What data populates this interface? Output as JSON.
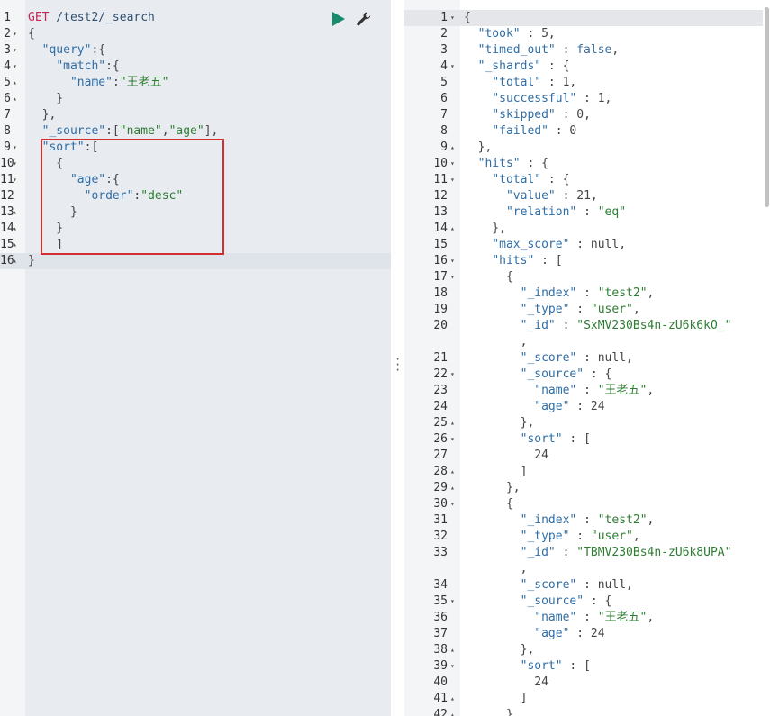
{
  "request": {
    "method": "GET",
    "path": " /test2/_search",
    "lines": [
      [
        [
          "p",
          "{"
        ]
      ],
      [
        [
          "p",
          "  "
        ],
        [
          "k",
          "\"query\""
        ],
        [
          "p",
          ":{"
        ]
      ],
      [
        [
          "p",
          "    "
        ],
        [
          "k",
          "\"match\""
        ],
        [
          "p",
          ":{"
        ]
      ],
      [
        [
          "p",
          "      "
        ],
        [
          "k",
          "\"name\""
        ],
        [
          "p",
          ":"
        ],
        [
          "s",
          "\"王老五\""
        ]
      ],
      [
        [
          "p",
          "    }"
        ]
      ],
      [
        [
          "p",
          "  },"
        ]
      ],
      [
        [
          "p",
          "  "
        ],
        [
          "k",
          "\"_source\""
        ],
        [
          "p",
          ":["
        ],
        [
          "s",
          "\"name\""
        ],
        [
          "p",
          ","
        ],
        [
          "s",
          "\"age\""
        ],
        [
          "p",
          "],"
        ]
      ],
      [
        [
          "p",
          "  "
        ],
        [
          "k",
          "\"sort\""
        ],
        [
          "p",
          ":["
        ]
      ],
      [
        [
          "p",
          "    {"
        ]
      ],
      [
        [
          "p",
          "      "
        ],
        [
          "k",
          "\"age\""
        ],
        [
          "p",
          ":{"
        ]
      ],
      [
        [
          "p",
          "        "
        ],
        [
          "k",
          "\"order\""
        ],
        [
          "p",
          ":"
        ],
        [
          "s",
          "\"desc\""
        ]
      ],
      [
        [
          "p",
          "      }"
        ]
      ],
      [
        [
          "p",
          "    }"
        ]
      ],
      [
        [
          "p",
          "    ]"
        ]
      ],
      [
        [
          "p",
          "}"
        ]
      ]
    ]
  },
  "response": {
    "lines": [
      {
        "n": "1",
        "f": "▾",
        "t": [
          [
            "p",
            "{"
          ]
        ]
      },
      {
        "n": "2",
        "t": [
          [
            "p",
            "  "
          ],
          [
            "k",
            "\"took\""
          ],
          [
            "p",
            " : 5,"
          ]
        ]
      },
      {
        "n": "3",
        "t": [
          [
            "p",
            "  "
          ],
          [
            "k",
            "\"timed_out\""
          ],
          [
            "p",
            " : "
          ],
          [
            "kw",
            "false"
          ],
          [
            "p",
            ","
          ]
        ]
      },
      {
        "n": "4",
        "f": "▾",
        "t": [
          [
            "p",
            "  "
          ],
          [
            "k",
            "\"_shards\""
          ],
          [
            "p",
            " : {"
          ]
        ]
      },
      {
        "n": "5",
        "t": [
          [
            "p",
            "    "
          ],
          [
            "k",
            "\"total\""
          ],
          [
            "p",
            " : 1,"
          ]
        ]
      },
      {
        "n": "6",
        "t": [
          [
            "p",
            "    "
          ],
          [
            "k",
            "\"successful\""
          ],
          [
            "p",
            " : 1,"
          ]
        ]
      },
      {
        "n": "7",
        "t": [
          [
            "p",
            "    "
          ],
          [
            "k",
            "\"skipped\""
          ],
          [
            "p",
            " : 0,"
          ]
        ]
      },
      {
        "n": "8",
        "t": [
          [
            "p",
            "    "
          ],
          [
            "k",
            "\"failed\""
          ],
          [
            "p",
            " : 0"
          ]
        ]
      },
      {
        "n": "9",
        "f": "▴",
        "t": [
          [
            "p",
            "  },"
          ]
        ]
      },
      {
        "n": "10",
        "f": "▾",
        "t": [
          [
            "p",
            "  "
          ],
          [
            "k",
            "\"hits\""
          ],
          [
            "p",
            " : {"
          ]
        ]
      },
      {
        "n": "11",
        "f": "▾",
        "t": [
          [
            "p",
            "    "
          ],
          [
            "k",
            "\"total\""
          ],
          [
            "p",
            " : {"
          ]
        ]
      },
      {
        "n": "12",
        "t": [
          [
            "p",
            "      "
          ],
          [
            "k",
            "\"value\""
          ],
          [
            "p",
            " : 21,"
          ]
        ]
      },
      {
        "n": "13",
        "t": [
          [
            "p",
            "      "
          ],
          [
            "k",
            "\"relation\""
          ],
          [
            "p",
            " : "
          ],
          [
            "s",
            "\"eq\""
          ]
        ]
      },
      {
        "n": "14",
        "f": "▴",
        "t": [
          [
            "p",
            "    },"
          ]
        ]
      },
      {
        "n": "15",
        "t": [
          [
            "p",
            "    "
          ],
          [
            "k",
            "\"max_score\""
          ],
          [
            "p",
            " : null,"
          ]
        ]
      },
      {
        "n": "16",
        "f": "▾",
        "t": [
          [
            "p",
            "    "
          ],
          [
            "k",
            "\"hits\""
          ],
          [
            "p",
            " : ["
          ]
        ]
      },
      {
        "n": "17",
        "f": "▾",
        "t": [
          [
            "p",
            "      {"
          ]
        ]
      },
      {
        "n": "18",
        "t": [
          [
            "p",
            "        "
          ],
          [
            "k",
            "\"_index\""
          ],
          [
            "p",
            " : "
          ],
          [
            "s",
            "\"test2\""
          ],
          [
            "p",
            ","
          ]
        ]
      },
      {
        "n": "19",
        "t": [
          [
            "p",
            "        "
          ],
          [
            "k",
            "\"_type\""
          ],
          [
            "p",
            " : "
          ],
          [
            "s",
            "\"user\""
          ],
          [
            "p",
            ","
          ]
        ]
      },
      {
        "n": "20",
        "t": [
          [
            "p",
            "        "
          ],
          [
            "k",
            "\"_id\""
          ],
          [
            "p",
            " : "
          ],
          [
            "s",
            "\"SxMV230Bs4n-zU6k6kO_\""
          ]
        ]
      },
      {
        "n": "",
        "t": [
          [
            "p",
            "        ,"
          ]
        ]
      },
      {
        "n": "21",
        "t": [
          [
            "p",
            "        "
          ],
          [
            "k",
            "\"_score\""
          ],
          [
            "p",
            " : null,"
          ]
        ]
      },
      {
        "n": "22",
        "f": "▾",
        "t": [
          [
            "p",
            "        "
          ],
          [
            "k",
            "\"_source\""
          ],
          [
            "p",
            " : {"
          ]
        ]
      },
      {
        "n": "23",
        "t": [
          [
            "p",
            "          "
          ],
          [
            "k",
            "\"name\""
          ],
          [
            "p",
            " : "
          ],
          [
            "s",
            "\"王老五\""
          ],
          [
            "p",
            ","
          ]
        ]
      },
      {
        "n": "24",
        "t": [
          [
            "p",
            "          "
          ],
          [
            "k",
            "\"age\""
          ],
          [
            "p",
            " : 24"
          ]
        ]
      },
      {
        "n": "25",
        "f": "▴",
        "t": [
          [
            "p",
            "        },"
          ]
        ]
      },
      {
        "n": "26",
        "f": "▾",
        "t": [
          [
            "p",
            "        "
          ],
          [
            "k",
            "\"sort\""
          ],
          [
            "p",
            " : ["
          ]
        ]
      },
      {
        "n": "27",
        "t": [
          [
            "p",
            "          24"
          ]
        ]
      },
      {
        "n": "28",
        "f": "▴",
        "t": [
          [
            "p",
            "        ]"
          ]
        ]
      },
      {
        "n": "29",
        "f": "▴",
        "t": [
          [
            "p",
            "      },"
          ]
        ]
      },
      {
        "n": "30",
        "f": "▾",
        "t": [
          [
            "p",
            "      {"
          ]
        ]
      },
      {
        "n": "31",
        "t": [
          [
            "p",
            "        "
          ],
          [
            "k",
            "\"_index\""
          ],
          [
            "p",
            " : "
          ],
          [
            "s",
            "\"test2\""
          ],
          [
            "p",
            ","
          ]
        ]
      },
      {
        "n": "32",
        "t": [
          [
            "p",
            "        "
          ],
          [
            "k",
            "\"_type\""
          ],
          [
            "p",
            " : "
          ],
          [
            "s",
            "\"user\""
          ],
          [
            "p",
            ","
          ]
        ]
      },
      {
        "n": "33",
        "t": [
          [
            "p",
            "        "
          ],
          [
            "k",
            "\"_id\""
          ],
          [
            "p",
            " : "
          ],
          [
            "s",
            "\"TBMV230Bs4n-zU6k8UPA\""
          ]
        ]
      },
      {
        "n": "",
        "t": [
          [
            "p",
            "        ,"
          ]
        ]
      },
      {
        "n": "34",
        "t": [
          [
            "p",
            "        "
          ],
          [
            "k",
            "\"_score\""
          ],
          [
            "p",
            " : null,"
          ]
        ]
      },
      {
        "n": "35",
        "f": "▾",
        "t": [
          [
            "p",
            "        "
          ],
          [
            "k",
            "\"_source\""
          ],
          [
            "p",
            " : {"
          ]
        ]
      },
      {
        "n": "36",
        "t": [
          [
            "p",
            "          "
          ],
          [
            "k",
            "\"name\""
          ],
          [
            "p",
            " : "
          ],
          [
            "s",
            "\"王老五\""
          ],
          [
            "p",
            ","
          ]
        ]
      },
      {
        "n": "37",
        "t": [
          [
            "p",
            "          "
          ],
          [
            "k",
            "\"age\""
          ],
          [
            "p",
            " : 24"
          ]
        ]
      },
      {
        "n": "38",
        "f": "▴",
        "t": [
          [
            "p",
            "        },"
          ]
        ]
      },
      {
        "n": "39",
        "f": "▾",
        "t": [
          [
            "p",
            "        "
          ],
          [
            "k",
            "\"sort\""
          ],
          [
            "p",
            " : ["
          ]
        ]
      },
      {
        "n": "40",
        "t": [
          [
            "p",
            "          24"
          ]
        ]
      },
      {
        "n": "41",
        "f": "▴",
        "t": [
          [
            "p",
            "        ]"
          ]
        ]
      },
      {
        "n": "42",
        "f": "▴",
        "t": [
          [
            "p",
            "      },"
          ]
        ]
      }
    ]
  },
  "gutter": {
    "request_numbers": [
      "1",
      "2",
      "3",
      "4",
      "5",
      "6",
      "7",
      "8",
      "9",
      "10",
      "11",
      "12",
      "13",
      "14",
      "15",
      "16"
    ],
    "request_folds": [
      "",
      "▾",
      "▾",
      "▾",
      "▴",
      "▴",
      "",
      "",
      "▾",
      "▾",
      "▾",
      "",
      "▴",
      "▴",
      "▴",
      "▴"
    ]
  },
  "colors": {
    "highlight_border": "#d32f2f",
    "run_icon": "#1a8a6e",
    "method": "#c62856"
  }
}
